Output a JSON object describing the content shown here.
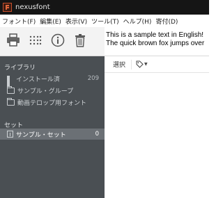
{
  "window": {
    "title": "nexusfont"
  },
  "menu": [
    "フォント(F)",
    "編集(E)",
    "表示(V)",
    "ツール(T)",
    "ヘルプ(H)",
    "寄付(D)"
  ],
  "toolbar": {
    "buttons": [
      "print-icon",
      "grid-dots-icon",
      "info-icon",
      "trash-icon"
    ]
  },
  "sample_text": {
    "line1": "This is a sample text in English!",
    "line2": "The quick brown fox jumps over"
  },
  "sidebar": {
    "library_title": "ライブラリ",
    "library_items": [
      {
        "label": "インストール済",
        "count": "209",
        "icon": "windows-icon"
      },
      {
        "label": "サンプル・グループ",
        "count": "",
        "icon": "folder-icon"
      },
      {
        "label": "動画テロップ用フォント",
        "count": "",
        "icon": "folder-icon"
      }
    ],
    "set_title": "セット",
    "set_items": [
      {
        "label": "サンプル・セット",
        "count": "0",
        "icon": "set-icon",
        "selected": true
      }
    ]
  },
  "list_toolbar": {
    "select_label": "選択",
    "tag_icon": "tag-icon"
  },
  "colors": {
    "titlebar": "#151515",
    "sidebar": "#4a4f53",
    "selected_row": "#6b7075",
    "app_icon_accent": "#e0673a"
  }
}
